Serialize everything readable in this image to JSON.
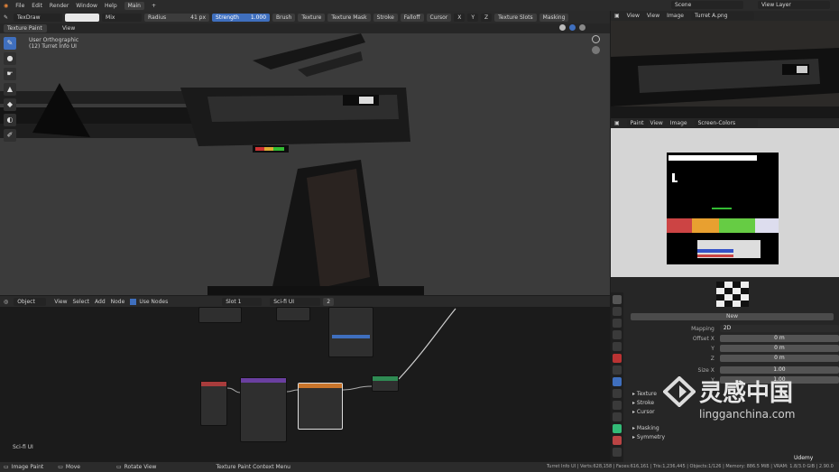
{
  "menu": {
    "items": [
      "File",
      "Edit",
      "Render",
      "Window",
      "Help"
    ],
    "workspace_tab": "Main",
    "scene": "Scene",
    "view_layer": "View Layer"
  },
  "toolbar": {
    "brush_name": "TexDraw",
    "blend": "Mix",
    "radius_label": "Radius",
    "radius_value": "41 px",
    "strength_label": "Strength",
    "strength_value": "1.000",
    "buttons": [
      "Brush",
      "Texture",
      "Texture Mask",
      "Stroke",
      "Falloff",
      "Cursor"
    ],
    "axes": [
      "X",
      "Y",
      "Z"
    ],
    "texture_slots": "Texture Slots",
    "masking": "Masking"
  },
  "viewport": {
    "mode": "Texture Paint",
    "view_menu": "View",
    "overlay_line1": "User Orthographic",
    "overlay_line2": "(12) Turret Info UI"
  },
  "image_editor_top": {
    "menus": [
      "View",
      "View",
      "Image"
    ],
    "image_name": "Turret A.png"
  },
  "image_editor_bottom": {
    "mode": "Paint",
    "menus": [
      "View",
      "Image"
    ],
    "image_name": "Screen-Colors"
  },
  "node_editor": {
    "type": "Object",
    "menus": [
      "View",
      "Select",
      "Add",
      "Node"
    ],
    "use_nodes": "Use Nodes",
    "slot": "Slot 1",
    "material": "Sci-fi UI",
    "user_count": "2",
    "frame_label": "Sci-fi UI"
  },
  "properties": {
    "new_button": "New",
    "mapping_label": "Mapping",
    "mapping_value": "2D",
    "offset": [
      {
        "label": "Offset X",
        "value": "0 m"
      },
      {
        "label": "Y",
        "value": "0 m"
      },
      {
        "label": "Z",
        "value": "0 m"
      }
    ],
    "size": [
      {
        "label": "Size X",
        "value": "1.00"
      },
      {
        "label": "Y",
        "value": "1.00"
      }
    ],
    "sections": [
      "Texture",
      "Stroke",
      "Cursor",
      "Masking",
      "Symmetry"
    ]
  },
  "status": {
    "left": [
      "Image Paint",
      "Move",
      "Rotate View",
      "Texture Paint Context Menu"
    ],
    "stats": "Turret Info UI | Verts:628,158 | Faces:616,161 | Tris:1,236,445 | Objects:1/126 | Memory: 886.5 MiB | VRAM: 1.8/3.0 GiB | 2.90.0"
  },
  "watermark": {
    "brand": "灵感中国",
    "url": "lingganchina.com",
    "udemy": "Udemy"
  },
  "colors": {
    "accent": "#3f6fbe",
    "node_purple": "#6a3fa0",
    "node_red": "#a83c3c",
    "node_orange": "#c9752b",
    "node_green": "#2f8b53"
  }
}
